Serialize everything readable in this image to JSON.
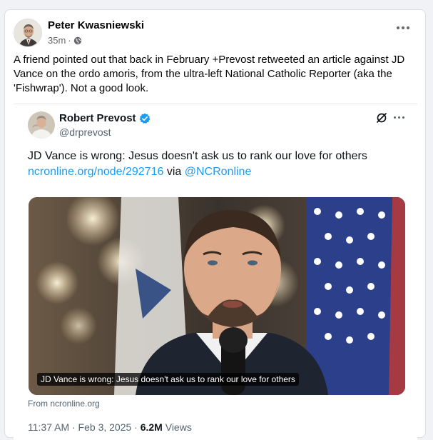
{
  "post": {
    "author": "Peter Kwasniewski",
    "time": "35m",
    "separator": "·",
    "privacy_icon": "globe-icon",
    "more_icon": "more-horizontal-icon",
    "text": "A friend pointed out that back in February +Prevost retweeted an article against JD Vance on the ordo amoris, from the ultra-left National Catholic Reporter (aka the 'Fishwrap'). Not a good look."
  },
  "tweet": {
    "name": "Robert Prevost",
    "handle": "@drprevost",
    "verified_icon": "verified-badge-icon",
    "grok_icon": "grok-icon",
    "more_icon": "more-horizontal-icon",
    "text": "JD Vance is wrong: Jesus doesn't ask us to rank our love for others",
    "link": "ncronline.org/node/292716",
    "via_text": "via",
    "mention": "@NCRonline",
    "card_caption": "JD Vance is wrong: Jesus doesn't ask us to rank our love for others",
    "card_source": "From ncronline.org",
    "timestamp": "11:37 AM · Feb 3, 2025 · ",
    "views_count": "6.2M",
    "views_label": " Views"
  },
  "colors": {
    "link": "#1d9bf0",
    "verified": "#1d9bf0",
    "background": "#f0f2f5"
  }
}
